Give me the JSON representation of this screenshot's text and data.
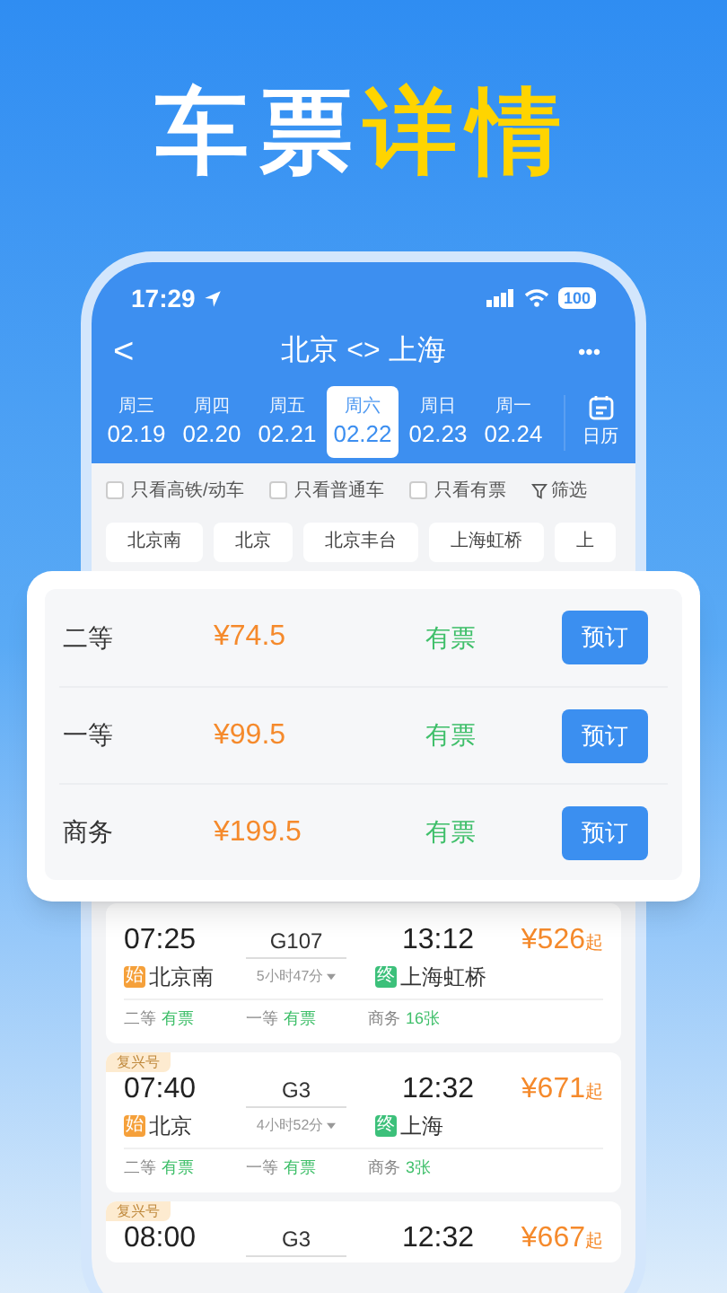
{
  "headline": {
    "white": "车票",
    "yellow": "详情"
  },
  "status_bar": {
    "time": "17:29",
    "battery": "100"
  },
  "nav": {
    "back": "<",
    "title": "北京 <> 上海",
    "more": "•••"
  },
  "dates": [
    {
      "weekday": "周三",
      "date": "02.19",
      "selected": false
    },
    {
      "weekday": "周四",
      "date": "02.20",
      "selected": false
    },
    {
      "weekday": "周五",
      "date": "02.21",
      "selected": false
    },
    {
      "weekday": "周六",
      "date": "02.22",
      "selected": true
    },
    {
      "weekday": "周日",
      "date": "02.23",
      "selected": false
    },
    {
      "weekday": "周一",
      "date": "02.24",
      "selected": false
    }
  ],
  "calendar": {
    "label": "日历"
  },
  "filters": [
    {
      "label": "只看高铁/动车",
      "checked": false
    },
    {
      "label": "只看普通车",
      "checked": false
    },
    {
      "label": "只看有票",
      "checked": false
    }
  ],
  "filter_button": "筛选",
  "stations": [
    "北京南",
    "北京",
    "北京丰台",
    "上海虹桥",
    "上"
  ],
  "seat_classes": [
    {
      "name": "二等",
      "price": "¥74.5",
      "availability": "有票",
      "button": "预订"
    },
    {
      "name": "一等",
      "price": "¥99.5",
      "availability": "有票",
      "button": "预订"
    },
    {
      "name": "商务",
      "price": "¥199.5",
      "availability": "有票",
      "button": "预订"
    }
  ],
  "trains": [
    {
      "depart": "07:25",
      "train_no": "G107",
      "arrive": "13:12",
      "price": "¥526",
      "price_suffix": "起",
      "from_mark": "始",
      "from": "北京南",
      "duration": "5小时47分",
      "to_mark": "终",
      "to": "上海虹桥",
      "seats": [
        {
          "class": "二等",
          "status": "有票"
        },
        {
          "class": "一等",
          "status": "有票"
        },
        {
          "class": "商务",
          "status": "16张"
        }
      ]
    },
    {
      "tag": "复兴号",
      "depart": "07:40",
      "train_no": "G3",
      "arrive": "12:32",
      "price": "¥671",
      "price_suffix": "起",
      "from_mark": "始",
      "from": "北京",
      "duration": "4小时52分",
      "to_mark": "终",
      "to": "上海",
      "seats": [
        {
          "class": "二等",
          "status": "有票"
        },
        {
          "class": "一等",
          "status": "有票"
        },
        {
          "class": "商务",
          "status": "3张"
        }
      ]
    },
    {
      "tag": "复兴号",
      "depart": "08:00",
      "train_no": "G3",
      "arrive": "12:32",
      "price": "¥667",
      "price_suffix": "起"
    }
  ]
}
